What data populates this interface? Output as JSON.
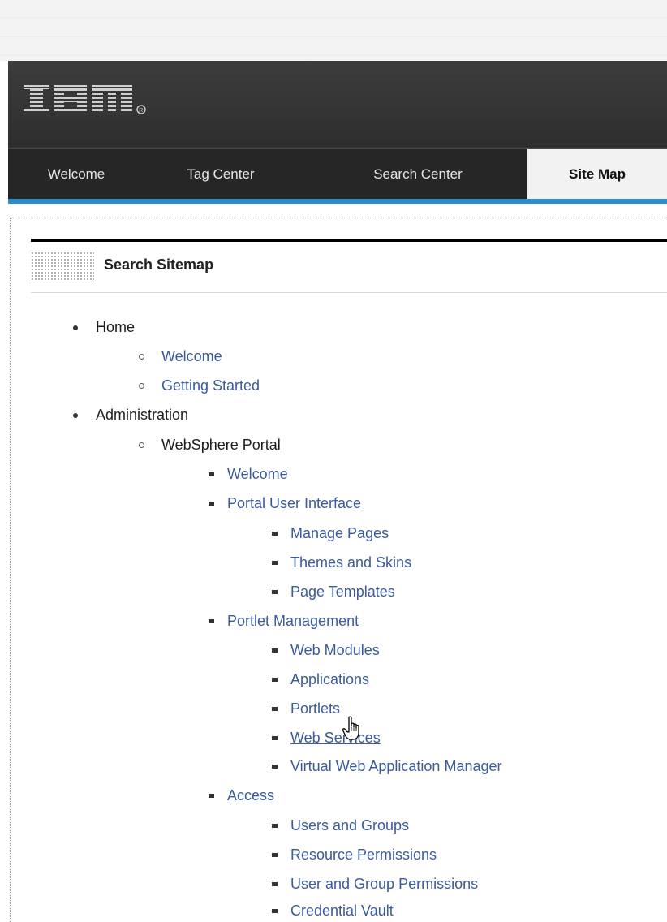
{
  "header": {
    "logo_text": "IBM",
    "registered": "®"
  },
  "nav": {
    "tabs": [
      "Welcome",
      "Tag Center",
      "Search Center",
      "Site Map"
    ],
    "active": "Site Map"
  },
  "portlet": {
    "title": "Search Sitemap"
  },
  "sitemap": {
    "home": {
      "label": "Home",
      "children": [
        "Welcome",
        "Getting Started"
      ]
    },
    "administration": {
      "label": "Administration",
      "websphere_portal": {
        "label": "WebSphere Portal",
        "welcome": "Welcome",
        "portal_user_interface": {
          "label": "Portal User Interface",
          "children": [
            "Manage Pages",
            "Themes and Skins",
            "Page Templates"
          ]
        },
        "portlet_management": {
          "label": "Portlet Management",
          "children": [
            "Web Modules",
            "Applications",
            "Portlets",
            "Web Services",
            "Virtual Web Application Manager"
          ]
        },
        "access": {
          "label": "Access",
          "children": [
            "Users and Groups",
            "Resource Permissions",
            "User and Group Permissions",
            "Credential Vault"
          ]
        }
      }
    }
  },
  "colors": {
    "accent": "#2a8cc8",
    "link": "#3b5b9c",
    "header": "#333333"
  }
}
